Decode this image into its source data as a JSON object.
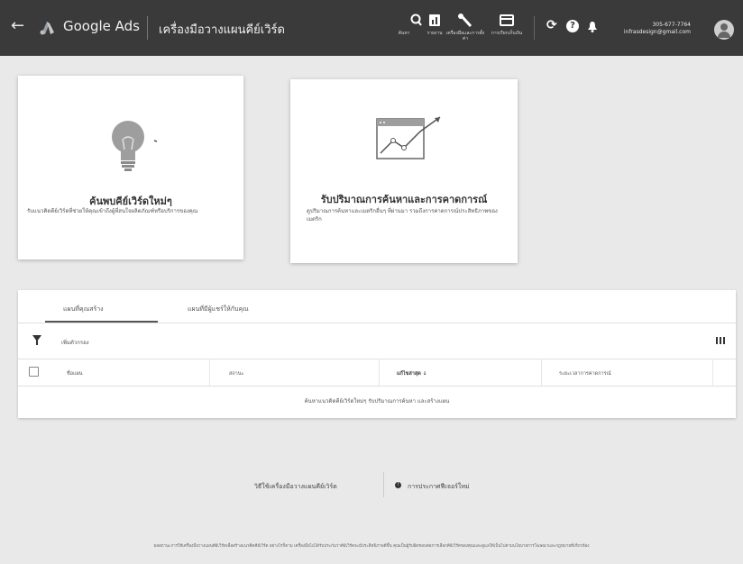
{
  "header": {
    "brand": "Google Ads",
    "tool_title": "เครื่องมือวางแผนคีย์เวิร์ด",
    "nav_items": [
      {
        "icon": "search-icon",
        "label": "ค้นหา"
      },
      {
        "icon": "reports-icon",
        "label": "รายงาน"
      },
      {
        "icon": "wrench-icon",
        "label": "เครื่องมือและการตั้งค่า"
      },
      {
        "icon": "billing-icon",
        "label": "การเรียกเก็บเงิน"
      }
    ],
    "account_phone": "305-677-7764",
    "account_email": "infrasdesign@gmail.com"
  },
  "cards": [
    {
      "title": "ค้นพบคีย์เวิร์ดใหม่ๆ",
      "description": "รับแนวคิดคีย์เวิร์ดที่ช่วยให้คุณเข้าถึงผู้ที่สนใจผลิตภัณฑ์หรือบริการของคุณ"
    },
    {
      "title": "รับปริมาณการค้นหาและการคาดการณ์",
      "description": "ดูปริมาณการค้นหาและเมตริกอื่นๆ ที่ผ่านมา รวมถึงการคาดการณ์ประสิทธิภาพของเมตริก"
    }
  ],
  "plans": {
    "tabs": [
      "แผนที่คุณสร้าง",
      "แผนที่มีผู้แชร์ให้กับคุณ"
    ],
    "filter_label": "เพิ่มตัวกรอง",
    "columns": [
      "ชื่อแผน",
      "สถานะ",
      "แก้ไขล่าสุด ↓",
      "ระยะเวลาการคาดการณ์"
    ],
    "empty_message": "ค้นหาแนวคิดคีย์เวิร์ดใหม่ๆ รับปริมาณการค้นหา และสร้างแผน"
  },
  "footer": {
    "how_to": "วิธีใช้เครื่องมือวางแผนคีย์เวิร์ด",
    "announcements": "การประกาศฟีเจอร์ใหม่",
    "disclaimer": "ผลสถานะการใช้เครื่องมือวางแผนคีย์เวิร์ดเพื่อสร้างแนวคิดคีย์เวิร์ด อย่างไรก็ตาม เครื่องมือไม่ได้รับประกันว่าคีย์เวิร์ดจะมีประสิทธิภาพดีขึ้น คุณเป็นผู้รับผิดชอบต่อการเลือกคีย์เวิร์ดของคุณและดูแลให้เป็นไปตามนโยบายการโฆษณาและกฎหมายที่เกี่ยวข้อง"
  },
  "colors": {
    "topbar": "#3a3a3a",
    "background": "#e9e9e9",
    "card": "#ffffff"
  }
}
